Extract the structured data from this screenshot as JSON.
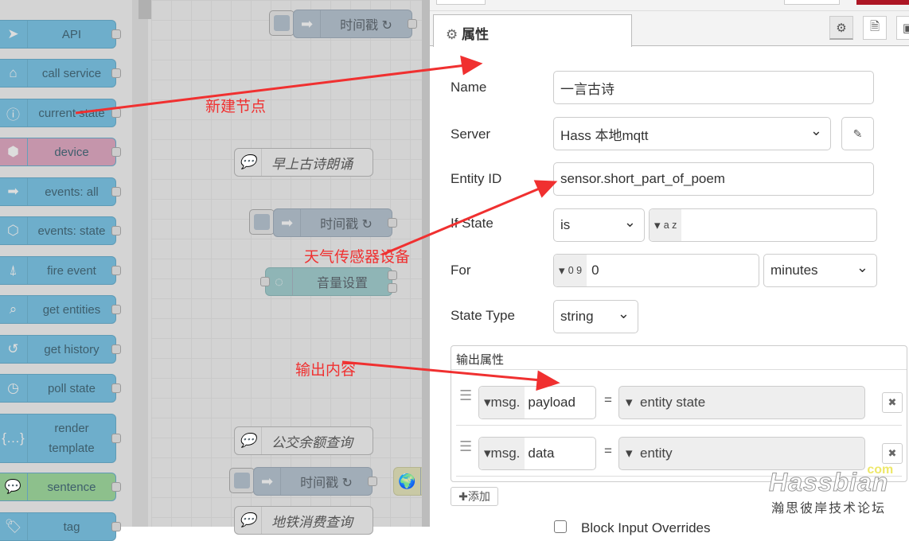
{
  "palette": {
    "nodes": [
      {
        "label": "API",
        "icon": "paper-plane-icon",
        "color": "#6eaecb"
      },
      {
        "label": "call service",
        "icon": "router-icon",
        "color": "#6eaecb"
      },
      {
        "label": "current state",
        "icon": "info-icon",
        "color": "#6eaecb"
      },
      {
        "label": "device",
        "icon": "cube-icon",
        "color": "#c595ab"
      },
      {
        "label": "events: all",
        "icon": "arrow-right-icon",
        "color": "#6eaecb"
      },
      {
        "label": "events: state",
        "icon": "hexagon-arrow-icon",
        "color": "#6eaecb"
      },
      {
        "label": "fire event",
        "icon": "antenna-icon",
        "color": "#6eaecb"
      },
      {
        "label": "get entities",
        "icon": "entities-search-icon",
        "color": "#6eaecb"
      },
      {
        "label": "get history",
        "icon": "history-icon",
        "color": "#6eaecb"
      },
      {
        "label": "poll state",
        "icon": "timer-icon",
        "color": "#6eaecb"
      },
      {
        "label": "render template",
        "icon": "braces-icon",
        "color": "#6eaecb"
      },
      {
        "label": "sentence",
        "icon": "speech-bubble-icon",
        "color": "#8dc08c"
      },
      {
        "label": "tag",
        "icon": "tag-icon",
        "color": "#6eaecb"
      }
    ]
  },
  "canvas": {
    "inject1": "时间戳 ↻",
    "comment1": "早上古诗朗诵",
    "inject2": "时间戳 ↻",
    "volume": "音量设置",
    "comment2": "公交余额查询",
    "inject3": "时间戳 ↻",
    "comment3": "地铁消费查询"
  },
  "annotations": {
    "a1": "新建节点",
    "a2": "天气传感器设备",
    "a3": "输出内容",
    "color": "#f03030"
  },
  "panel": {
    "tab": "属性",
    "name_label": "Name",
    "name_value": "一言古诗",
    "server_label": "Server",
    "server_value": "Hass 本地mqtt",
    "entity_label": "Entity ID",
    "entity_value": "sensor.short_part_of_poem",
    "ifstate_label": "If State",
    "ifstate_op": "is",
    "ifstate_type": "a z",
    "for_label": "For",
    "for_type": "0 9",
    "for_value": "0",
    "for_unit": "minutes",
    "statetype_label": "State Type",
    "statetype_value": "string",
    "output_header": "输出属性",
    "outputs": [
      {
        "prefix": "msg.",
        "prop": "payload",
        "eq": "=",
        "value": "entity state"
      },
      {
        "prefix": "msg.",
        "prop": "data",
        "eq": "=",
        "value": "entity"
      }
    ],
    "add_label": "添加",
    "block_label": "Block Input Overrides"
  },
  "watermark": {
    "brand": "Hassbian",
    "domain": "com",
    "sub": "瀚思彼岸技术论坛"
  }
}
